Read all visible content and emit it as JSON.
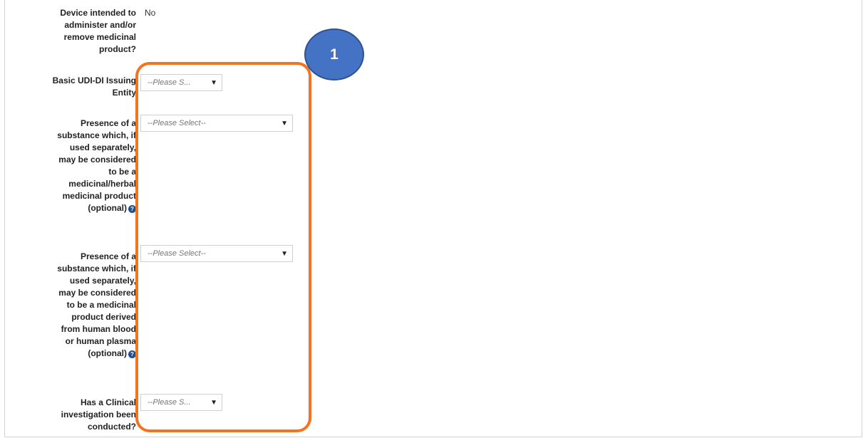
{
  "fields": [
    {
      "label_lines": [
        "Device intended to",
        "administer and/or",
        "remove medicinal",
        "product?"
      ],
      "value": "No"
    },
    {
      "label_lines": [
        "Basic UDI-DI Issuing",
        "Entity"
      ],
      "select_text": "--Please S..."
    },
    {
      "label_lines": [
        "Presence of a",
        "substance which, if",
        "used separately,",
        "may be considered",
        "to be a",
        "medicinal/herbal",
        "medicinal product",
        "(optional)"
      ],
      "select_text": "--Please Select--",
      "help_icon": "question-circle-icon"
    },
    {
      "label_lines": [
        "Presence of a",
        "substance which, if",
        "used separately,",
        "may be considered",
        "to be a medicinal",
        "product derived",
        "from human blood",
        "or human plasma",
        "(optional)"
      ],
      "select_text": "--Please Select--",
      "help_icon": "question-circle-icon"
    },
    {
      "label_lines": [
        "Has a Clinical",
        "investigation been",
        "conducted?"
      ],
      "select_text": "--Please S..."
    }
  ],
  "annotation": {
    "badge_number": "1",
    "highlight_color": "#f47320",
    "badge_color": "#4472c4"
  },
  "colors": {
    "help_icon": "#1d4f91"
  }
}
